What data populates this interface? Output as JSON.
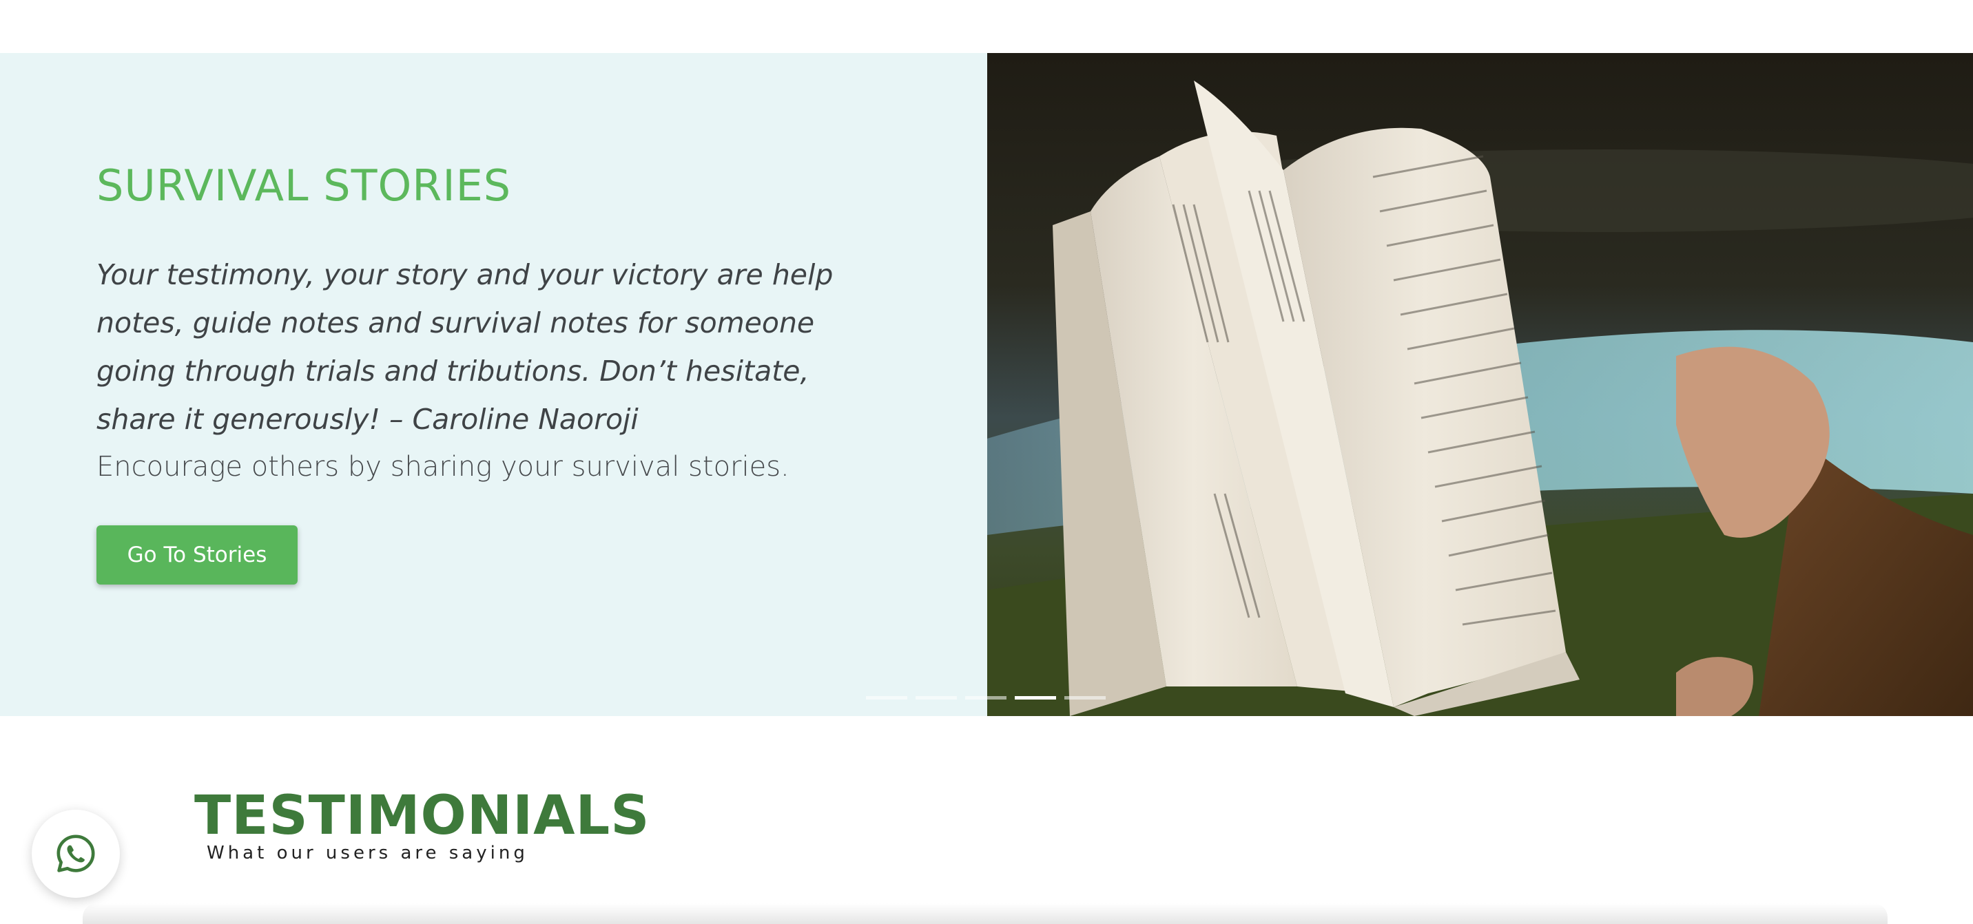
{
  "hero": {
    "title": "SURVIVAL STORIES",
    "quote": "Your testimony, your story and your victory are help notes, guide notes and survival notes for someone going through trials and tributions. Don’t hesitate, share it generously! – Caroline Naoroji",
    "body": "Encourage others by sharing your survival stories.",
    "button_label": "Go To Stories",
    "image_subject": "open-book-photo",
    "slider": {
      "total": 5,
      "active": 4
    }
  },
  "testimonials": {
    "title": "TESTIMONIALS",
    "subtitle": "What our users are saying"
  },
  "floating": {
    "whatsapp_icon": "whatsapp-icon"
  },
  "colors": {
    "accent_green": "#5cb85c",
    "heading_green": "#3e7a3b",
    "hero_bg": "#e8f5f6",
    "button_green": "#59b65b"
  }
}
